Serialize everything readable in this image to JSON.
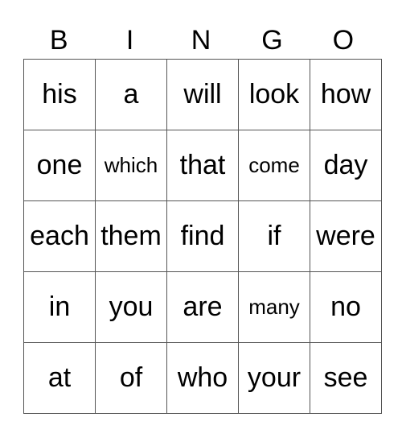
{
  "header": [
    "B",
    "I",
    "N",
    "G",
    "O"
  ],
  "rows": [
    [
      "his",
      "a",
      "will",
      "look",
      "how"
    ],
    [
      "one",
      "which",
      "that",
      "come",
      "day"
    ],
    [
      "each",
      "them",
      "find",
      "if",
      "were"
    ],
    [
      "in",
      "you",
      "are",
      "many",
      "no"
    ],
    [
      "at",
      "of",
      "who",
      "your",
      "see"
    ]
  ]
}
